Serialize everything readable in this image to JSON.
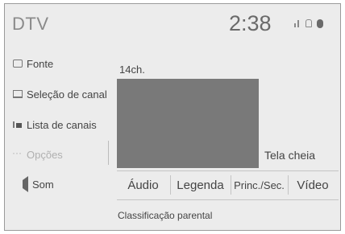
{
  "header": {
    "title": "DTV",
    "clock": "2:38"
  },
  "status_icons": [
    "signal-icon",
    "lock-icon",
    "device-icon"
  ],
  "sidebar": {
    "items": [
      {
        "label": "Fonte",
        "icon": "source-icon",
        "enabled": true
      },
      {
        "label": "Seleção de canal",
        "icon": "monitor-icon",
        "enabled": true
      },
      {
        "label": "Lista de canais",
        "icon": "list-icon",
        "enabled": true
      },
      {
        "label": "Opções",
        "icon": "more-icon",
        "enabled": false
      },
      {
        "label": "Som",
        "icon": "speaker-icon",
        "enabled": true
      }
    ]
  },
  "main": {
    "channel": "14ch.",
    "fullscreen_label": "Tela cheia",
    "tabs": [
      "Áudio",
      "Legenda",
      "Princ./Sec.",
      "Vídeo"
    ],
    "parental_label": "Classificação parental"
  }
}
